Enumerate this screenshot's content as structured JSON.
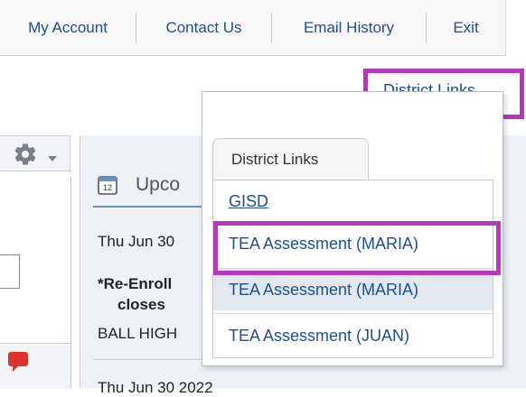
{
  "topnav": {
    "items": [
      "My Account",
      "Contact Us",
      "Email History",
      "Exit"
    ]
  },
  "district_links": {
    "link_label": "District Links",
    "tab_label": "District Links",
    "items": [
      "GISD",
      "TEA Assessment (MARIA)",
      "TEA Assessment (MARIA)",
      "TEA Assessment (JUAN)"
    ]
  },
  "upcoming": {
    "title": "Upco",
    "event_date": "Thu Jun 30",
    "event_title_line1": "*Re-Enroll",
    "event_title_line2": "closes",
    "event_location": "BALL HIGH",
    "next_date": "Thu Jun 30 2022"
  },
  "colors": {
    "accent": "#b23ab8",
    "link": "#1f4e8f",
    "hover": "#e3e8ef"
  }
}
